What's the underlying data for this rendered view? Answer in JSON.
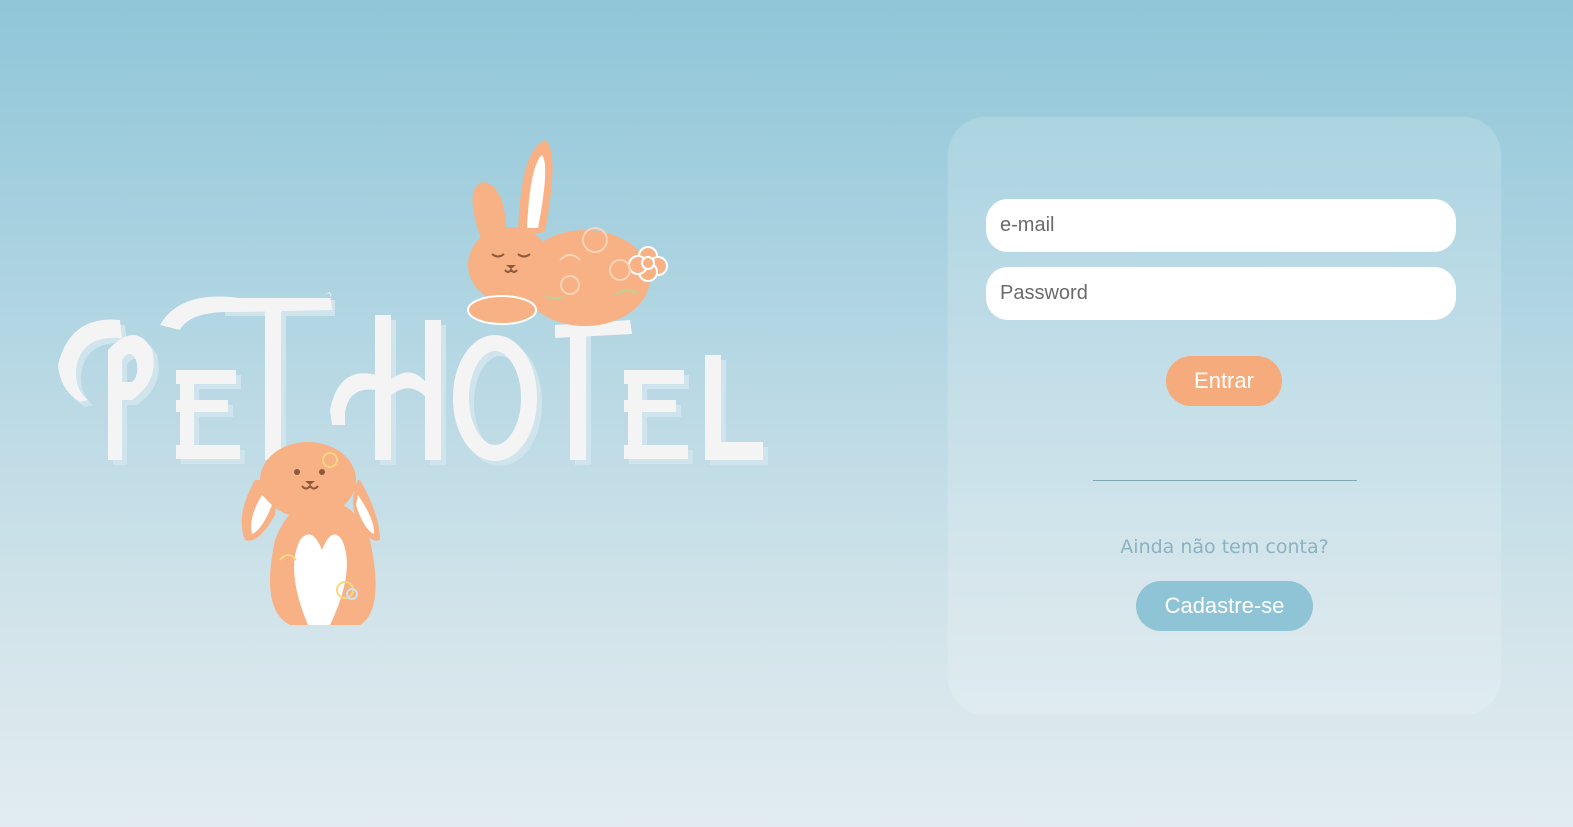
{
  "logo": {
    "text": "PET HOTEL",
    "letter_color": "#f4f4f4",
    "shadow_color": "#d0e6ee",
    "bunny_color": "#f7b184",
    "bunny_detail_color": "#8b5a3c"
  },
  "login": {
    "email_placeholder": "e-mail",
    "password_placeholder": "Password",
    "enter_label": "Entrar",
    "signup_prompt": "Ainda não tem conta?",
    "signup_label": "Cadastre-se"
  },
  "colors": {
    "accent": "#f5ab7c",
    "secondary": "#8fc4d6"
  }
}
